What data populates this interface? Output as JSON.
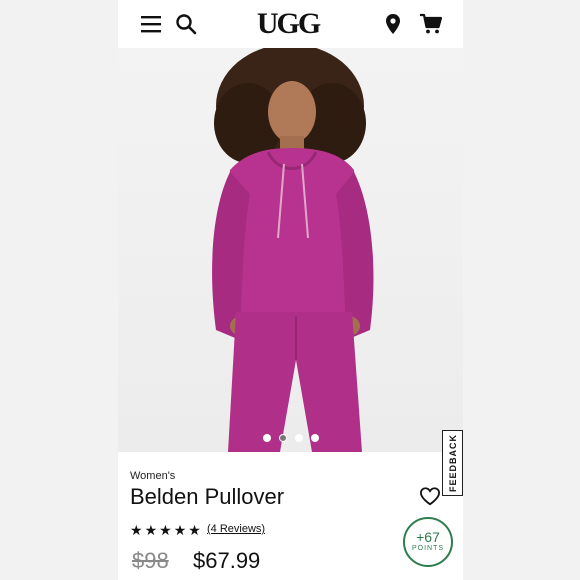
{
  "header": {
    "logo_text": "UGG",
    "icons": [
      "menu-icon",
      "search-icon",
      "location-pin-icon",
      "cart-icon"
    ]
  },
  "hero": {
    "slide_count": 4,
    "active_slide": 2,
    "garment_color": "#b8338f"
  },
  "feedback_label": "FEEDBACK",
  "product": {
    "category": "Women's",
    "name": "Belden Pullover",
    "rating": 5,
    "reviews_link": "(4 Reviews)",
    "original_price": "$98",
    "sale_price": "$67.99"
  },
  "rewards": {
    "value": "+67",
    "label": "POINTS",
    "color": "#2e7d4f"
  }
}
